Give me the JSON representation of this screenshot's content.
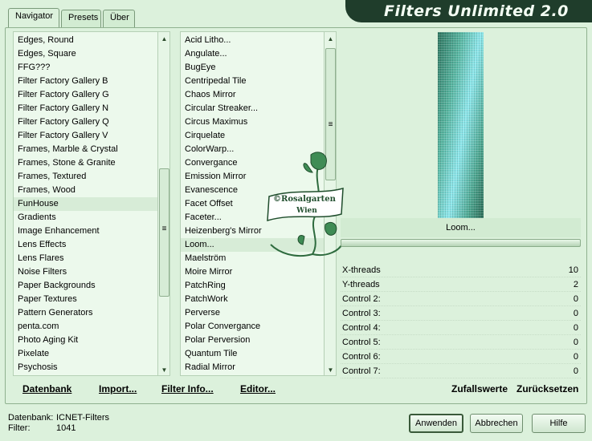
{
  "tabs": [
    {
      "label": "Navigator",
      "active": true
    },
    {
      "label": "Presets",
      "active": false
    },
    {
      "label": "Über",
      "active": false
    }
  ],
  "app_title": "Filters Unlimited 2.0",
  "categories": {
    "items": [
      "Edges, Round",
      "Edges, Square",
      "FFG???",
      "Filter Factory Gallery B",
      "Filter Factory Gallery G",
      "Filter Factory Gallery N",
      "Filter Factory Gallery Q",
      "Filter Factory Gallery V",
      "Frames, Marble & Crystal",
      "Frames, Stone & Granite",
      "Frames, Textured",
      "Frames, Wood",
      "FunHouse",
      "Gradients",
      "Image Enhancement",
      "Lens Effects",
      "Lens Flares",
      "Noise Filters",
      "Paper Backgrounds",
      "Paper Textures",
      "Pattern Generators",
      "penta.com",
      "Photo Aging Kit",
      "Pixelate",
      "Psychosis"
    ],
    "selected": "FunHouse"
  },
  "filters": {
    "items": [
      "Acid Litho...",
      "Angulate...",
      "BugEye",
      "Centripedal Tile",
      "Chaos Mirror",
      "Circular Streaker...",
      "Circus Maximus",
      "Cirquelate",
      "ColorWarp...",
      "Convergance",
      "Emission Mirror",
      "Evanescence",
      "Facet Offset",
      "Faceter...",
      "Heizenberg's Mirror",
      "Loom...",
      "Maelström",
      "Moire Mirror",
      "PatchRing",
      "PatchWork",
      "Perverse",
      "Polar Convergance",
      "Polar Perversion",
      "Quantum Tile",
      "Radial Mirror"
    ],
    "selected": "Loom..."
  },
  "bottom_links": {
    "database": "Datenbank",
    "import": "Import...",
    "filter_info": "Filter Info...",
    "editor": "Editor...",
    "random": "Zufallswerte",
    "reset": "Zurücksetzen"
  },
  "preview": {
    "filter_name": "Loom...",
    "colors": {
      "dark": "#2d7560",
      "light": "#8fe9ee"
    }
  },
  "parameters": [
    {
      "label": "X-threads",
      "value": "10"
    },
    {
      "label": "Y-threads",
      "value": "2"
    },
    {
      "label": "Control 2:",
      "value": "0"
    },
    {
      "label": "Control 3:",
      "value": "0"
    },
    {
      "label": "Control 4:",
      "value": "0"
    },
    {
      "label": "Control 5:",
      "value": "0"
    },
    {
      "label": "Control 6:",
      "value": "0"
    },
    {
      "label": "Control 7:",
      "value": "0"
    }
  ],
  "status": {
    "database_label": "Datenbank:",
    "database_value": "ICNET-Filters",
    "filter_label": "Filter:",
    "filter_value": "1041"
  },
  "buttons": {
    "apply": "Anwenden",
    "cancel": "Abbrechen",
    "help": "Hilfe"
  },
  "watermark": {
    "line1": "©Rosalgarten",
    "line2": "Wien"
  }
}
